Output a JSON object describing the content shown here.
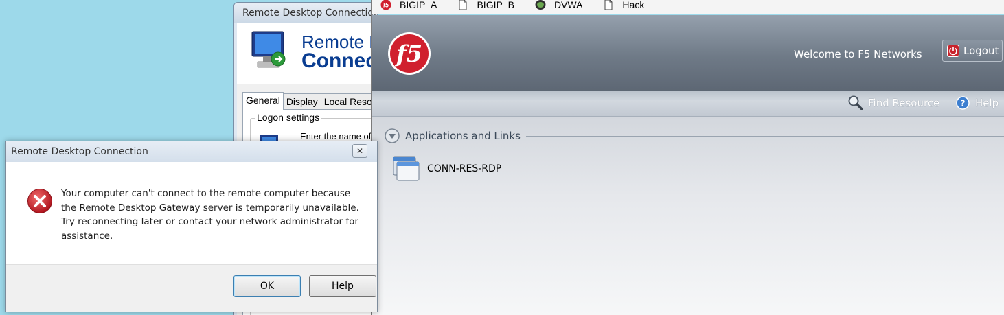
{
  "rdc_window": {
    "title": "Remote Desktop Connection",
    "banner_line1": "Remote Desktop",
    "banner_line2": "Connection",
    "tabs": [
      {
        "label": "General"
      },
      {
        "label": "Display"
      },
      {
        "label": "Local Resources"
      }
    ],
    "logon_settings_label": "Logon settings",
    "logon_text": "Enter the name of the remote computer."
  },
  "error_dialog": {
    "title": "Remote Desktop Connection",
    "message": "Your computer can't connect to the remote computer because\nthe Remote Desktop Gateway server is temporarily unavailable.\nTry reconnecting later or contact your network administrator for\nassistance.",
    "ok_label": "OK",
    "help_label": "Help",
    "close_glyph": "✕"
  },
  "browser": {
    "bookmarks": [
      {
        "label": "BIGIP_A",
        "icon": "f5-icon"
      },
      {
        "label": "BIGIP_B",
        "icon": "page-icon"
      },
      {
        "label": "DVWA",
        "icon": "dvwa-icon"
      },
      {
        "label": "Hack",
        "icon": "page-icon"
      }
    ]
  },
  "f5_portal": {
    "logo_text": "f5",
    "welcome_text": "Welcome to F5 Networks",
    "logout_label": "Logout",
    "find_resource_label": "Find Resource",
    "help_label": "Help",
    "section_title": "Applications and Links",
    "resources": [
      {
        "label": "CONN-RES-RDP"
      }
    ]
  },
  "colors": {
    "desktop_bg": "#9dd9ea",
    "f5_red": "#d0202e",
    "rdc_blue": "#0a3d91",
    "error_red": "#c8232c"
  }
}
